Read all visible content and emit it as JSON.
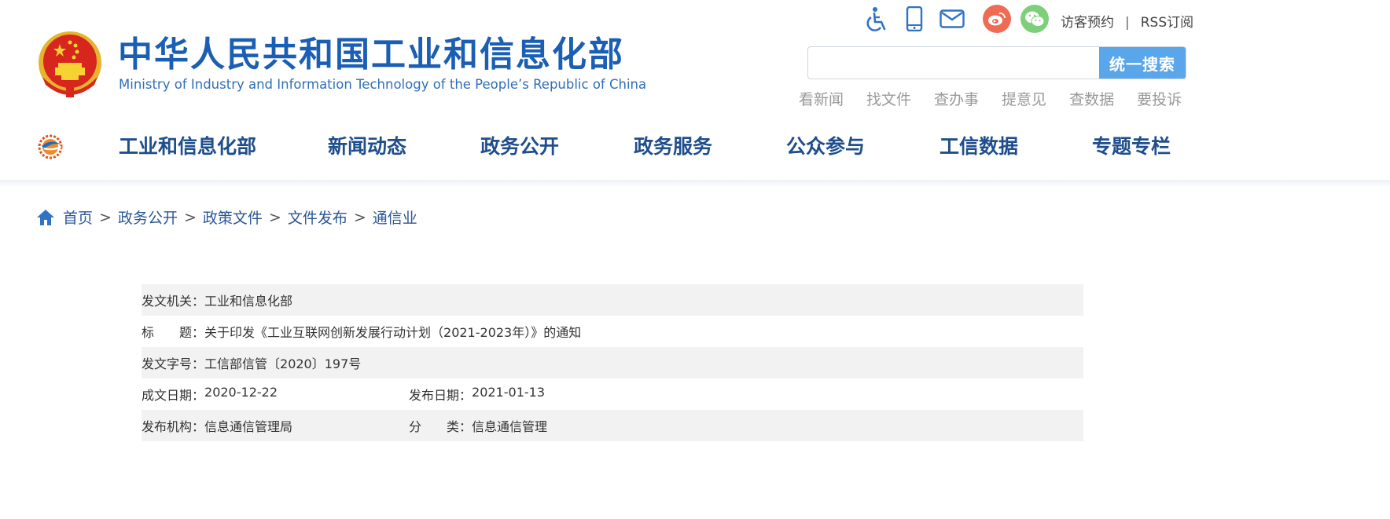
{
  "header": {
    "title": "中华人民共和国工业和信息化部",
    "subtitle": "Ministry of Industry and Information Technology of the People’s Republic of China",
    "top_icons": [
      "accessibility-icon",
      "mobile-icon",
      "mail-icon",
      "weibo-icon",
      "wechat-icon"
    ],
    "visitor_link": "访客预约",
    "separator": "|",
    "rss_link": "RSS订阅",
    "search": {
      "placeholder": "",
      "button": "统一搜索"
    },
    "quick_links": [
      "看新闻",
      "找文件",
      "查办事",
      "提意见",
      "查数据",
      "要投诉"
    ]
  },
  "nav": {
    "items": [
      "工业和信息化部",
      "新闻动态",
      "政务公开",
      "政务服务",
      "公众参与",
      "工信数据",
      "专题专栏"
    ]
  },
  "breadcrumb": {
    "items": [
      "首页",
      "政务公开",
      "政策文件",
      "文件发布",
      "通信业"
    ],
    "sep": ">"
  },
  "doc_info": {
    "issuer_label": "发文机关：",
    "issuer": "工业和信息化部",
    "title_label": "标　　题：",
    "title": "关于印发《工业互联网创新发展行动计划（2021-2023年）》的通知",
    "docno_label": "发文字号：",
    "docno": "工信部信管〔2020〕197号",
    "written_label": "成文日期：",
    "written": "2020-12-22",
    "published_label": "发布日期：",
    "published": "2021-01-13",
    "org_label": "发布机构：",
    "org": "信息通信管理局",
    "category_label": "分　　类：",
    "category": "信息通信管理"
  },
  "colors": {
    "brand_blue": "#1a5fb4",
    "search_button": "#5aa6ea",
    "weibo": "#ef6b54",
    "wechat": "#7dcf7a"
  }
}
